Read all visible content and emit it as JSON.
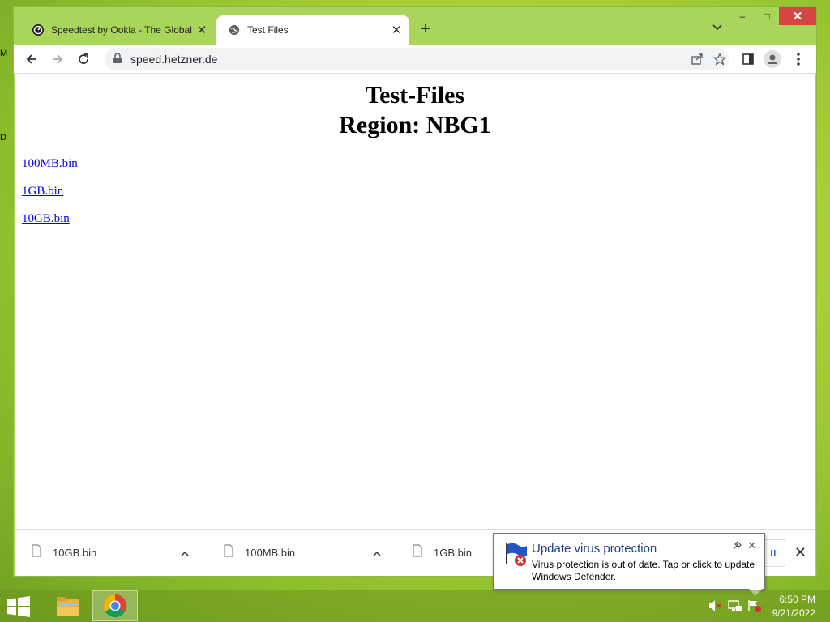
{
  "desktop": {
    "label_1": "M",
    "label_2": "D"
  },
  "browser": {
    "tabs": [
      {
        "title": "Speedtest by Ookla - The Global Broadband Speed Test",
        "icon": "speedtest-icon",
        "active": false
      },
      {
        "title": "Test Files",
        "icon": "globe-icon",
        "active": true
      }
    ],
    "new_tab_label": "+",
    "tab_search_icon": "chevron-down-icon",
    "window_controls": {
      "minimize": "–",
      "maximize": "□",
      "close": "✕"
    },
    "url": "speed.hetzner.de",
    "toolbar_icons": [
      "back-icon",
      "forward-icon",
      "reload-icon",
      "lock-icon",
      "share-icon",
      "star-icon",
      "side-panel-icon",
      "profile-icon",
      "menu-icon"
    ]
  },
  "page": {
    "heading_line1": "Test-Files",
    "heading_line2": "Region: NBG1",
    "links": [
      "100MB.bin",
      "1GB.bin",
      "10GB.bin"
    ]
  },
  "downloads": {
    "items": [
      {
        "name": "10GB.bin"
      },
      {
        "name": "100MB.bin"
      },
      {
        "name": "1GB.bin"
      }
    ],
    "close_label": "✕"
  },
  "notification": {
    "title": "Update virus protection",
    "body": "Virus protection is out of date. Tap or click to update Windows Defender.",
    "close_label": "✕"
  },
  "taskbar": {
    "time": "6:50 PM",
    "date": "9/21/2022",
    "apps": [
      "file-explorer-icon",
      "chrome-icon"
    ],
    "tray": [
      "volume-muted-icon",
      "network-icon",
      "action-center-flag-icon"
    ]
  }
}
